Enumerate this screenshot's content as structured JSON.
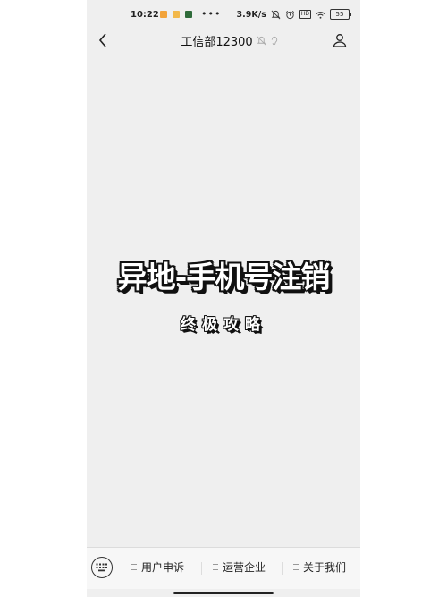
{
  "status_bar": {
    "time": "10:22",
    "more": "•••",
    "net_speed": "3.9K/s",
    "hd_label": "HD",
    "battery": "55"
  },
  "nav": {
    "title": "工信部12300",
    "back_icon": "chevron-left-icon",
    "profile_icon": "person-icon"
  },
  "content": {
    "headline": "异地-手机号注销",
    "subheadline": "终极攻略"
  },
  "bottom_menu": {
    "keyboard_icon": "keyboard-icon",
    "items": [
      {
        "label": "用户申诉"
      },
      {
        "label": "运营企业"
      },
      {
        "label": "关于我们"
      }
    ]
  },
  "colors": {
    "background": "#efefef",
    "headline_fill": "#ffffff",
    "headline_outline": "#111111"
  }
}
